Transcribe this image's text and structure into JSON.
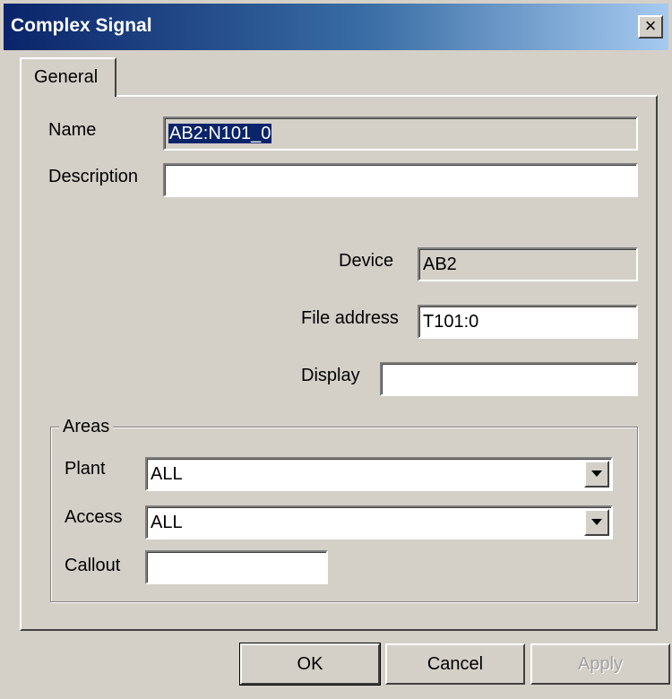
{
  "window": {
    "title": "Complex Signal",
    "close_glyph": "×"
  },
  "tabs": [
    {
      "label": "General"
    }
  ],
  "fields": {
    "name": {
      "label": "Name",
      "value": "AB2:N101_0"
    },
    "description": {
      "label": "Description",
      "value": ""
    },
    "device": {
      "label": "Device",
      "value": "AB2"
    },
    "file_address": {
      "label": "File address",
      "value": "T101:0"
    },
    "display": {
      "label": "Display",
      "value": ""
    }
  },
  "areas": {
    "title": "Areas",
    "plant": {
      "label": "Plant",
      "value": "ALL"
    },
    "access": {
      "label": "Access",
      "value": "ALL"
    },
    "callout": {
      "label": "Callout",
      "value": ""
    }
  },
  "buttons": {
    "ok": "OK",
    "cancel": "Cancel",
    "apply": "Apply"
  }
}
